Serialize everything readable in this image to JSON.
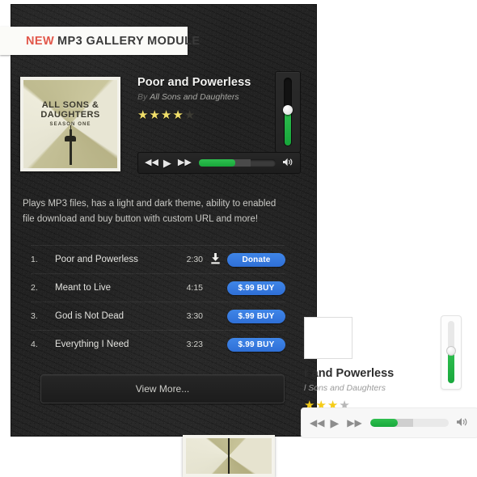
{
  "ribbon": {
    "new_label": "NEW",
    "title": "MP3 GALLERY MODULE"
  },
  "colors": {
    "accent_green": "#2fbf4f",
    "accent_blue": "#3f86e8",
    "badge_red": "#e2574a",
    "star_on_dark": "#f2e06a",
    "star_on_light": "#f5cc18",
    "panel_dark": "#232323"
  },
  "dark_player": {
    "album_art": {
      "line1": "ALL SONS &",
      "line2": "DAUGHTERS",
      "subtitle": "SEASON ONE"
    },
    "song_title": "Poor and Powerless",
    "by_label": "By",
    "artist": "All Sons and Daughters",
    "rating": 4,
    "rating_max": 5,
    "volume_percent": 52,
    "progress_percent": 47,
    "buffer_percent": 67,
    "controls": {
      "prev": "◀◀",
      "play": "▶",
      "next": "▶▶",
      "speaker": "🔊"
    }
  },
  "description": "Plays MP3 files, has a light and dark theme, ability to enabled file download and buy button with custom URL and more!",
  "playlist": {
    "tracks": [
      {
        "num": "1.",
        "name": "Poor and Powerless",
        "time": "2:30",
        "download": true,
        "action": "Donate"
      },
      {
        "num": "2.",
        "name": "Meant to Live",
        "time": "4:15",
        "download": false,
        "action": "$.99 BUY"
      },
      {
        "num": "3.",
        "name": "God is Not Dead",
        "time": "3:30",
        "download": false,
        "action": "$.99 BUY"
      },
      {
        "num": "4.",
        "name": "Everything I Need",
        "time": "3:23",
        "download": false,
        "action": "$.99 BUY"
      }
    ],
    "download_glyph": "⤓",
    "view_more_label": "View More..."
  },
  "light_player": {
    "song_title": "r and Powerless",
    "artist": "l Sons and Daughters",
    "rating": 3,
    "rating_max": 5,
    "volume_percent": 50,
    "progress_percent": 35,
    "buffer_percent": 55,
    "controls": {
      "prev": "◀◀",
      "play": "▶",
      "next": "▶▶",
      "speaker": "🔊"
    }
  }
}
